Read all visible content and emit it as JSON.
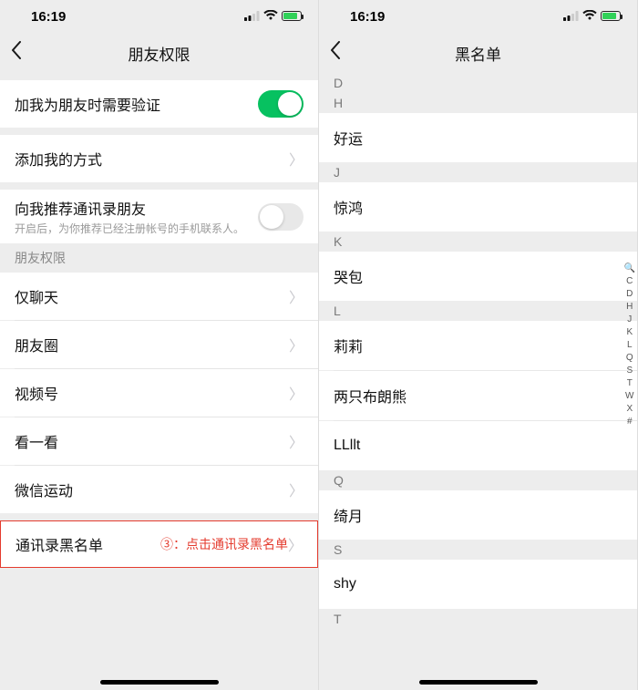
{
  "left": {
    "status_time": "16:19",
    "nav_title": "朋友权限",
    "rows": {
      "verify": "加我为朋友时需要验证",
      "add_method": "添加我的方式",
      "recommend": "向我推荐通讯录朋友",
      "recommend_sub": "开启后，为你推荐已经注册帐号的手机联系人。",
      "section": "朋友权限",
      "chat_only": "仅聊天",
      "moments": "朋友圈",
      "channels": "视频号",
      "top_stories": "看一看",
      "werun": "微信运动",
      "blocklist": "通讯录黑名单"
    },
    "annotation": "③：点击通讯录黑名单"
  },
  "right": {
    "status_time": "16:19",
    "nav_title": "黑名单",
    "groups": [
      {
        "letter": "D",
        "items": []
      },
      {
        "letter": "H",
        "items": [
          "好运"
        ]
      },
      {
        "letter": "J",
        "items": [
          "惊鸿"
        ]
      },
      {
        "letter": "K",
        "items": [
          "哭包"
        ]
      },
      {
        "letter": "L",
        "items": [
          "莉莉",
          "两只布朗熊",
          "LLllt"
        ]
      },
      {
        "letter": "Q",
        "items": [
          "绮月"
        ]
      },
      {
        "letter": "S",
        "items": [
          "shy"
        ]
      },
      {
        "letter": "T",
        "items": []
      }
    ],
    "index": [
      "🔍",
      "C",
      "D",
      "H",
      "J",
      "K",
      "L",
      "Q",
      "S",
      "T",
      "W",
      "X",
      "#"
    ]
  }
}
